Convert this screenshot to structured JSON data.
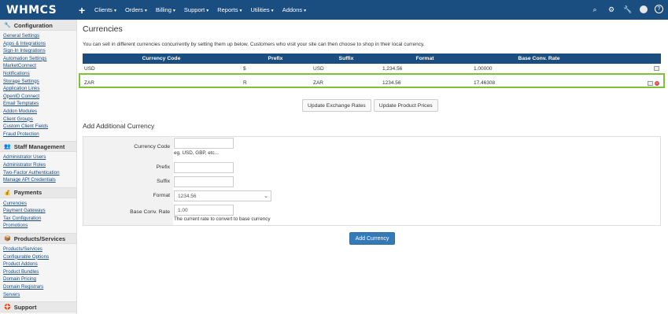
{
  "brand": {
    "logo": "WHMCS",
    "plus": "+"
  },
  "nav": [
    "Clients",
    "Orders",
    "Billing",
    "Support",
    "Reports",
    "Utilities",
    "Addons"
  ],
  "nav_caret": "▾",
  "top_icons": [
    "search-icon",
    "gear-icon",
    "wrench-icon",
    "avatar",
    "help-icon"
  ],
  "sidebar": [
    {
      "icon": "wrench-icon",
      "glyph": "🔧",
      "title": "Configuration",
      "links": [
        "General Settings",
        "Apps & Integrations",
        "Sign-In Integrations",
        "Automation Settings",
        "MarketConnect",
        "Notifications",
        "Storage Settings",
        "Application Links",
        "OpenID Connect",
        "Email Templates",
        "Addon Modules",
        "Client Groups",
        "Custom Client Fields",
        "Fraud Protection"
      ]
    },
    {
      "icon": "users-icon",
      "glyph": "👥",
      "title": "Staff Management",
      "links": [
        "Administrator Users",
        "Administrator Roles",
        "Two-Factor Authentication",
        "Manage API Credentials"
      ]
    },
    {
      "icon": "money-icon",
      "glyph": "💰",
      "title": "Payments",
      "links": [
        "Currencies",
        "Payment Gateways",
        "Tax Configuration",
        "Promotions"
      ]
    },
    {
      "icon": "box-icon",
      "glyph": "📦",
      "title": "Products/Services",
      "links": [
        "Products/Services",
        "Configurable Options",
        "Product Addons",
        "Product Bundles",
        "Domain Pricing",
        "Domain Registrars",
        "Servers"
      ]
    },
    {
      "icon": "support-icon",
      "glyph": "🛟",
      "title": "Support",
      "links": []
    }
  ],
  "page": {
    "title": "Currencies",
    "description": "You can sell in different currencies concurrently by setting them up below. Customers who visit your site can then choose to shop in their local currency."
  },
  "table": {
    "headers": [
      "Currency Code",
      "Prefix",
      "Suffix",
      "Format",
      "Base Conv. Rate"
    ],
    "rows": [
      {
        "code": "USD",
        "prefix": "$",
        "suffix": "USD",
        "format": "1,234.56",
        "rate": "1.00000",
        "delete": false
      },
      {
        "code": "ZAR",
        "prefix": "R",
        "suffix": "ZAR",
        "format": "1234.56",
        "rate": "17.46308",
        "delete": true
      }
    ]
  },
  "buttons": {
    "update_rates": "Update Exchange Rates",
    "update_prices": "Update Product Prices",
    "add_currency": "Add Currency"
  },
  "form": {
    "title": "Add Additional Currency",
    "code_label": "Currency Code",
    "code_value": "",
    "code_help": "eg. USD, GBP, etc...",
    "prefix_label": "Prefix",
    "prefix_value": "",
    "suffix_label": "Suffix",
    "suffix_value": "",
    "format_label": "Format",
    "format_value": "1234.56",
    "rate_label": "Base Conv. Rate",
    "rate_value": "1.00",
    "rate_help": "The current rate to convert to base currency"
  },
  "colors": {
    "topbar": "#1a4d80",
    "highlight": "#7ec335",
    "primary_button": "#337ab7"
  }
}
